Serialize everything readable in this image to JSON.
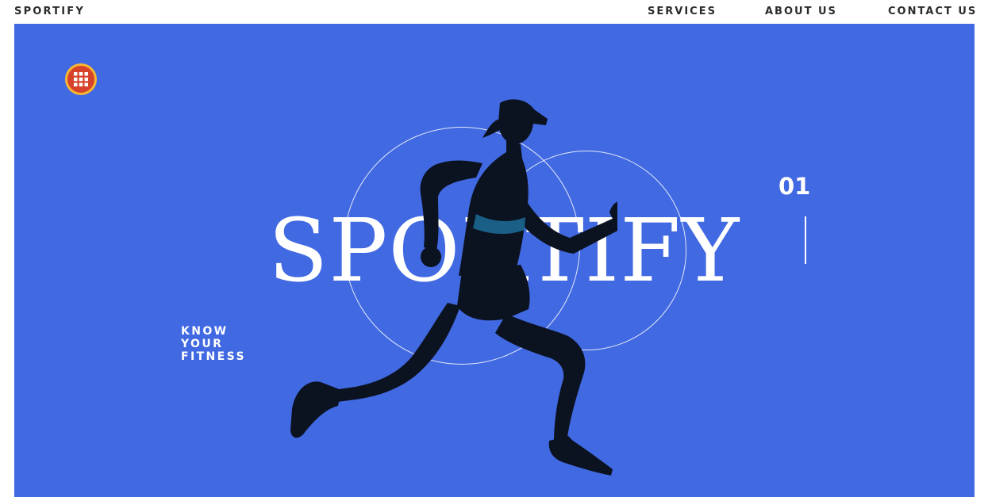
{
  "header": {
    "brand": "SPORTIFY",
    "nav": [
      "SERVICES",
      "ABOUT US",
      "CONTACT US"
    ]
  },
  "hero": {
    "title": "SPORTIFY",
    "slide_number": "01",
    "tagline": [
      "KNOW",
      "YOUR",
      "FITNESS"
    ],
    "menu_icon": "grid-menu-icon",
    "colors": {
      "background": "#4169e1",
      "menu_button": "#d6432a",
      "menu_button_ring": "#f7b733",
      "text": "#ffffff",
      "nav_text": "#2b2b2b"
    }
  }
}
